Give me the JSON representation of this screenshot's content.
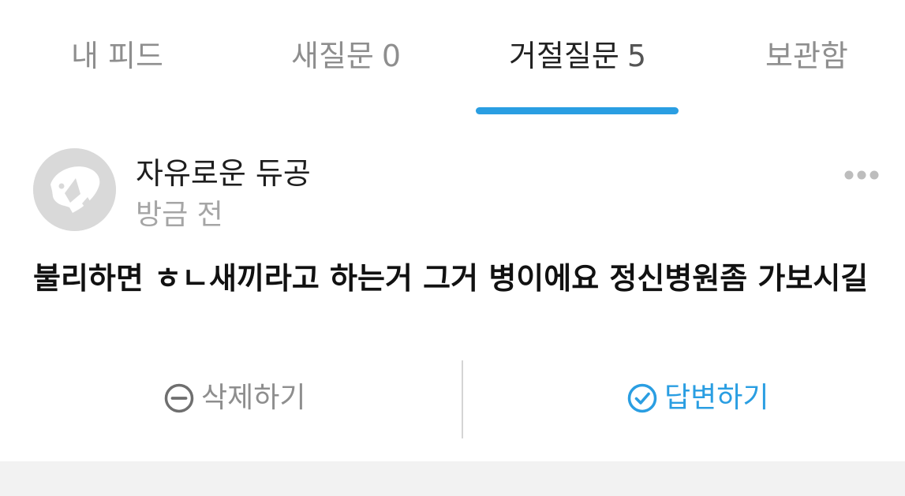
{
  "tabs": [
    {
      "label": "내 피드",
      "count": "",
      "active": false
    },
    {
      "label": "새질문",
      "count": "0",
      "active": false
    },
    {
      "label": "거절질문",
      "count": "5",
      "active": true
    },
    {
      "label": "보관함",
      "count": "",
      "active": false
    }
  ],
  "post": {
    "author": "자유로운 듀공",
    "time": "방금 전",
    "avatar_icon": "default-animal-avatar-icon",
    "more_icon": "more-dots-icon",
    "question": "불리하면 ㅎㄴ새끼라고 하는거 그거 병이에요 정신병원좀 가보시길"
  },
  "actions": {
    "delete_label": "삭제하기",
    "delete_icon": "minus-circle-icon",
    "answer_label": "답변하기",
    "answer_icon": "check-circle-icon"
  },
  "colors": {
    "accent": "#2a9ee2",
    "inactive_text": "#8e8e8e",
    "muted_text": "#a5a5a5",
    "avatar_bg": "#d9d9d9",
    "divider": "#d5d5d5",
    "band": "#f2f2f2"
  }
}
